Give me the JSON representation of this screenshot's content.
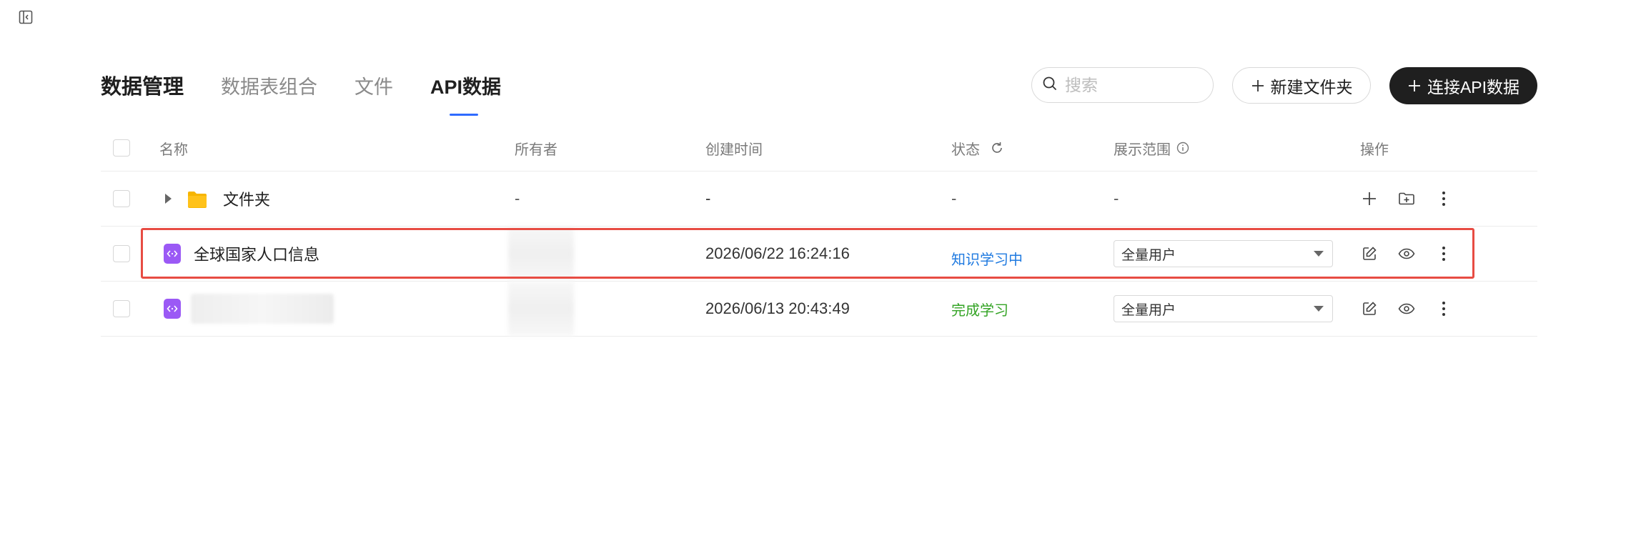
{
  "header": {
    "title": "数据管理",
    "tabs": [
      {
        "label": "数据表组合"
      },
      {
        "label": "文件"
      },
      {
        "label": "API数据"
      }
    ],
    "active_tab": "API数据"
  },
  "search": {
    "placeholder": "搜索",
    "icon": "search-icon"
  },
  "buttons": {
    "new_folder": "新建文件夹",
    "connect_api": "连接API数据"
  },
  "table": {
    "columns": [
      "名称",
      "所有者",
      "创建时间",
      "状态",
      "展示范围",
      "操作"
    ],
    "rows": [
      {
        "type": "folder",
        "name": "文件夹",
        "owner": "-",
        "created": "-",
        "status": "-",
        "scope": "-"
      },
      {
        "type": "api",
        "name": "全球国家人口信息",
        "owner": "",
        "created": "2026/06/22 16:24:16",
        "status": "知识学习中",
        "scope": "全量用户"
      },
      {
        "type": "api",
        "name": "",
        "owner": "",
        "created": "2026/06/13 20:43:49",
        "status": "完成学习",
        "scope": "全量用户"
      }
    ]
  },
  "colors": {
    "accent": "#2f6bff",
    "status_learning": "#1f7ae0",
    "status_done": "#33a324",
    "api_icon": "#9b59f5",
    "folder_icon": "#f7b500",
    "highlight": "#e74c43"
  }
}
